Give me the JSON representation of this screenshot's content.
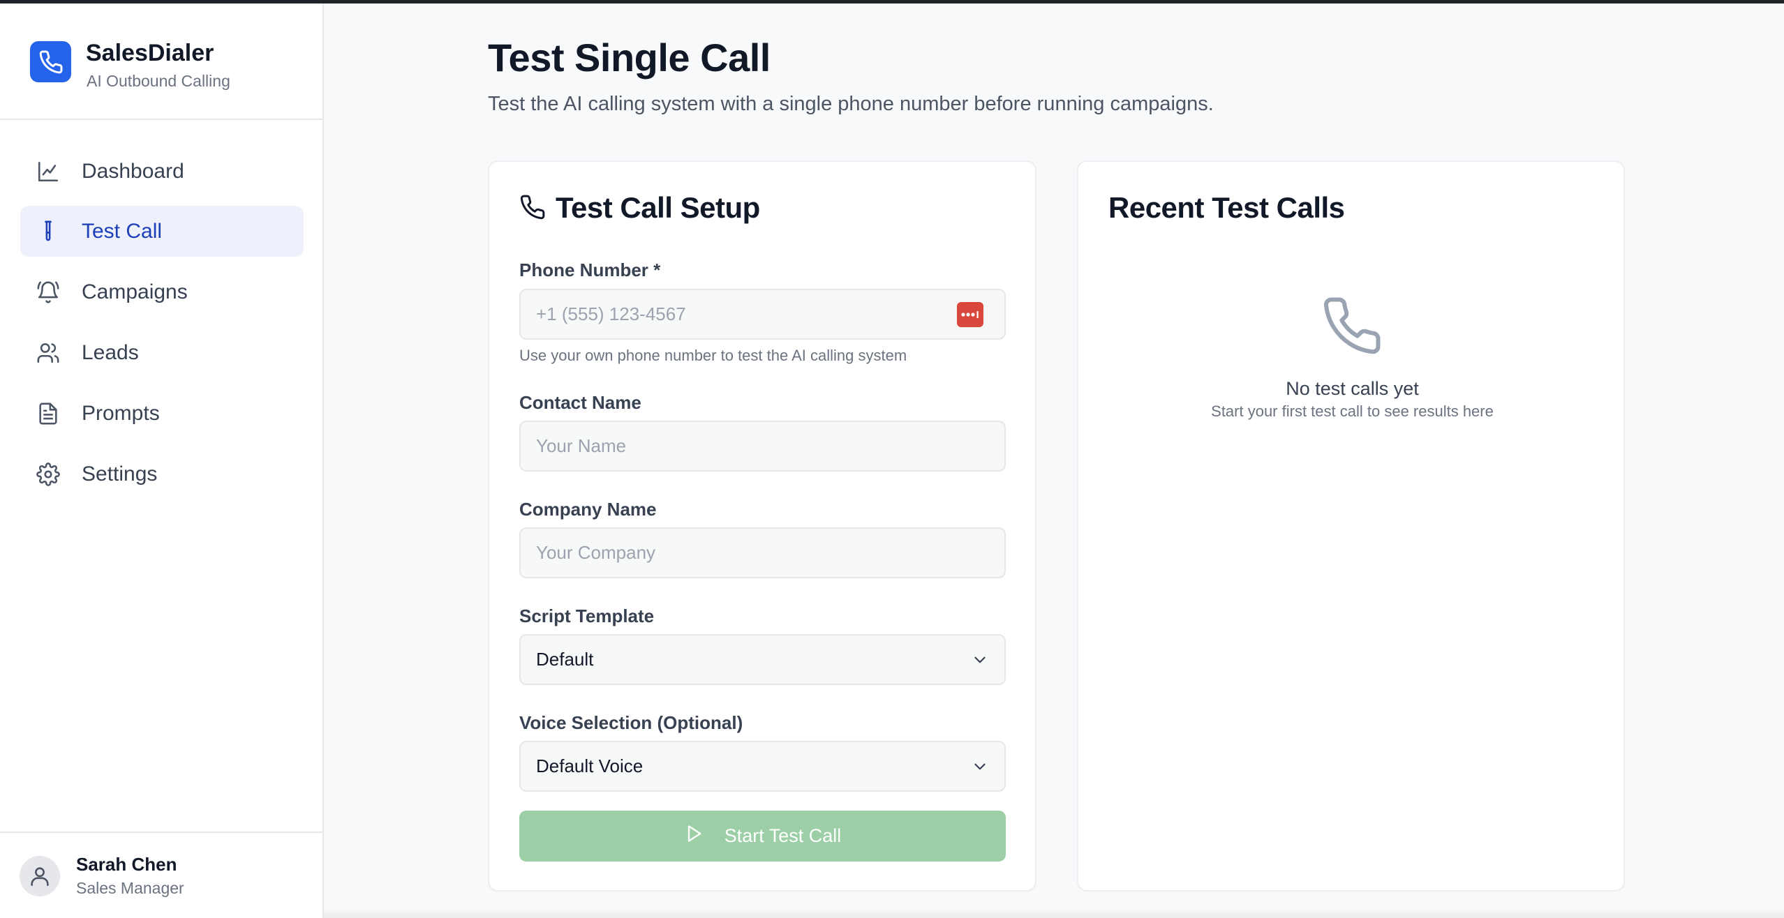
{
  "brand": {
    "title": "SalesDialer",
    "subtitle": "AI Outbound Calling",
    "accent": "#2563eb"
  },
  "nav": {
    "items": [
      {
        "label": "Dashboard",
        "icon": "chart-line-icon"
      },
      {
        "label": "Test Call",
        "icon": "test-tube-icon",
        "active": true
      },
      {
        "label": "Campaigns",
        "icon": "bell-ring-icon"
      },
      {
        "label": "Leads",
        "icon": "users-icon"
      },
      {
        "label": "Prompts",
        "icon": "file-text-icon"
      },
      {
        "label": "Settings",
        "icon": "gear-icon"
      }
    ]
  },
  "user": {
    "name": "Sarah Chen",
    "role": "Sales Manager"
  },
  "page": {
    "title": "Test Single Call",
    "subtitle": "Test the AI calling system with a single phone number before running campaigns."
  },
  "setup": {
    "title": "Test Call Setup",
    "phone": {
      "label": "Phone Number *",
      "placeholder": "+1 (555) 123-4567",
      "helper": "Use your own phone number to test the AI calling system"
    },
    "contact": {
      "label": "Contact Name",
      "placeholder": "Your Name"
    },
    "company": {
      "label": "Company Name",
      "placeholder": "Your Company"
    },
    "script": {
      "label": "Script Template",
      "value": "Default"
    },
    "voice": {
      "label": "Voice Selection (Optional)",
      "value": "Default Voice"
    },
    "start_button": "Start Test Call",
    "start_button_color": "#9dcfa7"
  },
  "recent": {
    "title": "Recent Test Calls",
    "empty_title": "No test calls yet",
    "empty_subtitle": "Start your first test call to see results here"
  }
}
